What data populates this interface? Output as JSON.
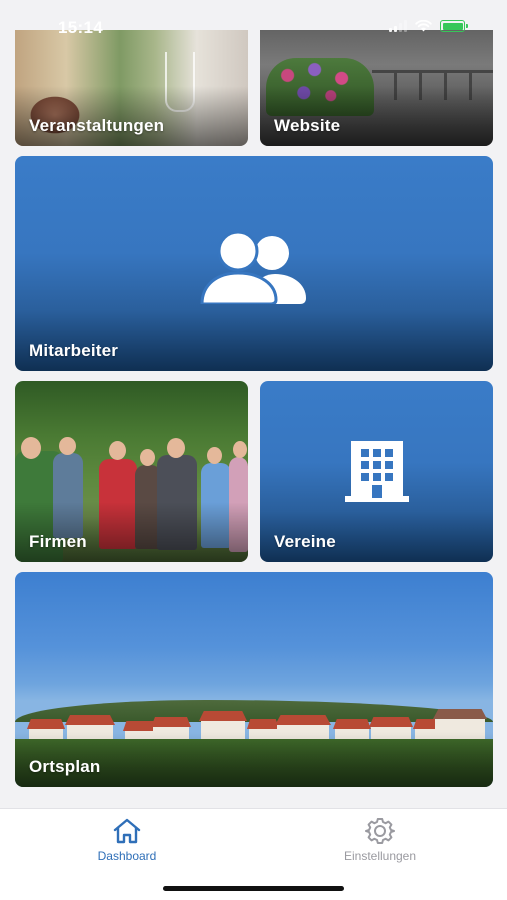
{
  "status_bar": {
    "time": "15:14"
  },
  "tiles": {
    "veranstaltungen": {
      "label": "Veranstaltungen"
    },
    "website": {
      "label": "Website"
    },
    "mitarbeiter": {
      "label": "Mitarbeiter",
      "icon": "users-icon"
    },
    "firmen": {
      "label": "Firmen"
    },
    "vereine": {
      "label": "Vereine",
      "icon": "building-icon"
    },
    "ortsplan": {
      "label": "Ortsplan"
    }
  },
  "tab_bar": {
    "items": [
      {
        "label": "Dashboard",
        "icon": "home-icon",
        "active": true
      },
      {
        "label": "Einstellungen",
        "icon": "gear-icon",
        "active": false
      }
    ]
  },
  "colors": {
    "tile_blue": "#3776c0",
    "tile_blue_dark": "#0f2f52",
    "tab_active": "#2f6fb8",
    "tab_inactive": "#9a9aa0",
    "battery": "#36c759"
  }
}
